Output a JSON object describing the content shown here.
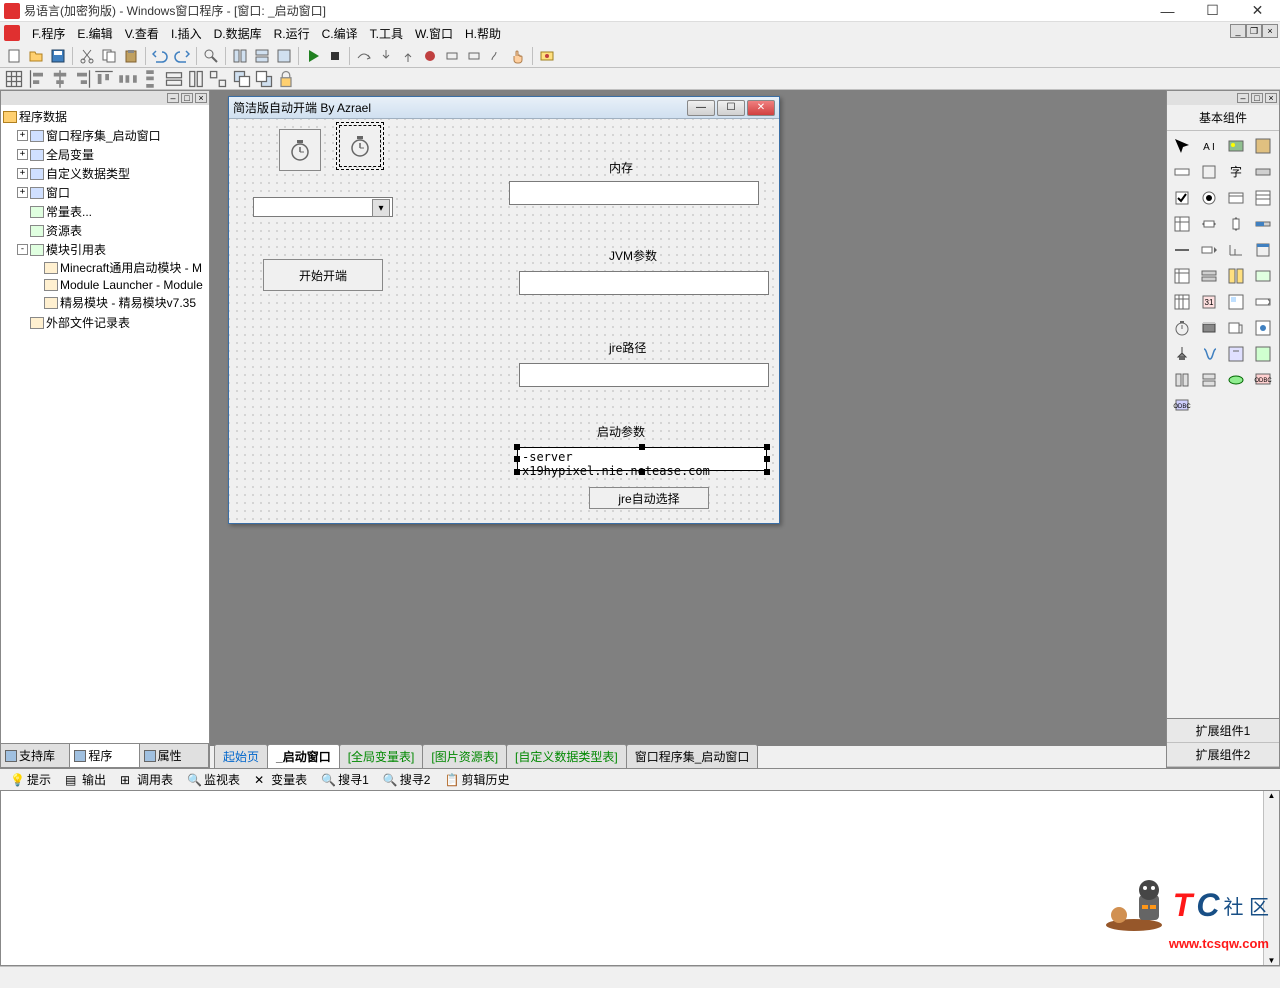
{
  "titlebar": {
    "title": "易语言(加密狗版) - Windows窗口程序 - [窗口: _启动窗口]",
    "min": "—",
    "max": "☐",
    "close": "✕"
  },
  "menubar": {
    "items": [
      "F.程序",
      "E.编辑",
      "V.查看",
      "I.插入",
      "D.数据库",
      "R.运行",
      "C.编译",
      "T.工具",
      "W.窗口",
      "H.帮助"
    ]
  },
  "left_panel": {
    "root": "程序数据",
    "nodes": [
      {
        "exp": "+",
        "icon": "win",
        "label": "窗口程序集_启动窗口"
      },
      {
        "exp": "+",
        "icon": "win",
        "label": "全局变量"
      },
      {
        "exp": "+",
        "icon": "win",
        "label": "自定义数据类型"
      },
      {
        "exp": "+",
        "icon": "win",
        "label": "窗口"
      },
      {
        "exp": "",
        "icon": "mod",
        "label": "常量表..."
      },
      {
        "exp": "",
        "icon": "mod",
        "label": "资源表"
      },
      {
        "exp": "-",
        "icon": "mod",
        "label": "模块引用表",
        "children": [
          {
            "icon": "file",
            "label": "Minecraft通用启动模块 - M"
          },
          {
            "icon": "file",
            "label": "Module Launcher - Module"
          },
          {
            "icon": "file",
            "label": "精易模块 - 精易模块v7.35"
          }
        ]
      },
      {
        "exp": "",
        "icon": "file",
        "label": "外部文件记录表"
      }
    ],
    "tabs": [
      "支持库",
      "程序",
      "属性"
    ]
  },
  "designer": {
    "title": "简洁版自动开端 By Azrael",
    "start_button": "开始开端",
    "labels": {
      "memory": "内存",
      "jvm": "JVM参数",
      "jre_path": "jre路径",
      "launch_args": "启动参数"
    },
    "textbox_value": "-server x19hypixel.nie.netease.com",
    "jre_auto_button": "jre自动选择"
  },
  "center_tabs": [
    "起始页",
    "_启动窗口",
    "[全局变量表]",
    "[图片资源表]",
    "[自定义数据类型表]",
    "窗口程序集_启动窗口"
  ],
  "right_panel": {
    "title": "基本组件",
    "bottom_tabs": [
      "扩展组件1",
      "扩展组件2"
    ]
  },
  "bottom_tabs": [
    "提示",
    "输出",
    "调用表",
    "监视表",
    "变量表",
    "搜寻1",
    "搜寻2",
    "剪辑历史"
  ],
  "watermark": {
    "t": "T",
    "c": "C",
    "sq": "社 区",
    "url": "www.tcsqw.com"
  }
}
